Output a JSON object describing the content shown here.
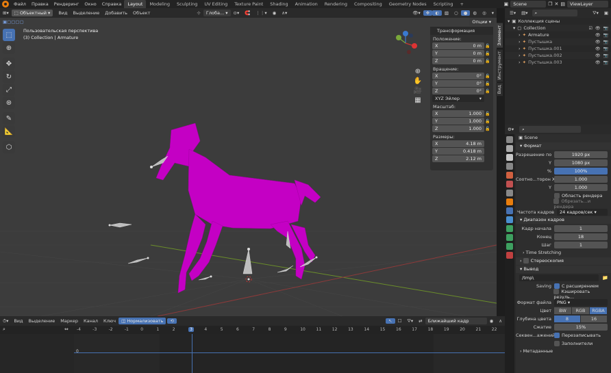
{
  "menu": {
    "items": [
      "Файл",
      "Правка",
      "Рендеринг",
      "Окно",
      "Справка"
    ],
    "workspaces": [
      "Layout",
      "Modeling",
      "Sculpting",
      "UV Editing",
      "Texture Paint",
      "Shading",
      "Animation",
      "Rendering",
      "Compositing",
      "Geometry Nodes",
      "Scripting"
    ],
    "active_workspace": "Layout",
    "scene": "Scene",
    "view_layer": "ViewLayer"
  },
  "viewport_header": {
    "mode": "Объектный",
    "menus": [
      "Вид",
      "Выделение",
      "Добавить",
      "Объект"
    ],
    "orientation": "Глоба...",
    "options": "Опции"
  },
  "viewport_info": {
    "line1": "Пользовательская перспектива",
    "line2": "(3) Collection | Armature"
  },
  "npanel": {
    "title": "Трансформация",
    "location_label": "Положение:",
    "location": [
      {
        "axis": "X",
        "value": "0 m"
      },
      {
        "axis": "Y",
        "value": "0 m"
      },
      {
        "axis": "Z",
        "value": "0 m"
      }
    ],
    "rotation_label": "Вращение:",
    "rotation": [
      {
        "axis": "X",
        "value": "0°"
      },
      {
        "axis": "Y",
        "value": "0°"
      },
      {
        "axis": "Z",
        "value": "0°"
      }
    ],
    "rotation_mode": "XYZ Эйлер",
    "scale_label": "Масштаб:",
    "scale": [
      {
        "axis": "X",
        "value": "1.000"
      },
      {
        "axis": "Y",
        "value": "1.000"
      },
      {
        "axis": "Z",
        "value": "1.000"
      }
    ],
    "dimensions_label": "Размеры:",
    "dimensions": [
      {
        "axis": "X",
        "value": "4.18 m"
      },
      {
        "axis": "Y",
        "value": "0.418 m"
      },
      {
        "axis": "Z",
        "value": "2.12 m"
      }
    ]
  },
  "side_tabs": [
    "Элемент",
    "Инструмент",
    "Вид"
  ],
  "timeline": {
    "menus": [
      "Вид",
      "Выделение",
      "Маркер",
      "Канал",
      "Ключ"
    ],
    "normalize": "Нормализовать",
    "interp": "Ближайший кадр",
    "ticks": [
      "-4",
      "-3",
      "-2",
      "-1",
      "0",
      "1",
      "2",
      "3",
      "4",
      "5",
      "6",
      "7",
      "8",
      "9",
      "10",
      "11",
      "12",
      "13",
      "14",
      "15",
      "16",
      "17",
      "18",
      "19",
      "20",
      "21",
      "22"
    ],
    "current_frame": "3",
    "row_value": "0"
  },
  "outliner": {
    "rows": [
      {
        "label": "Коллекция сцены",
        "indent": 0
      },
      {
        "label": "Collection",
        "indent": 1
      },
      {
        "label": "Armature",
        "indent": 2
      },
      {
        "label": "Пустышка",
        "indent": 2
      },
      {
        "label": "Пустышка.001",
        "indent": 2
      },
      {
        "label": "Пустышка.002",
        "indent": 2
      },
      {
        "label": "Пустышка.003",
        "indent": 2
      }
    ]
  },
  "properties": {
    "scene_name": "Scene",
    "format_title": "Формат",
    "resolution_label": "Разрешение по",
    "res_x": "1920 px",
    "y_label": "Y",
    "res_y": "1080 px",
    "pct_label": "%",
    "res_pct": "100%",
    "aspect_label": "Соотно...торон X",
    "aspect_x": "1.000",
    "aspect_y": "1.000",
    "render_region": "Область рендера",
    "crop_region": "Обрезать...и рендера",
    "fps_label": "Частота кадров",
    "fps": "24 кадров/сек",
    "frame_range_title": "Диапазон кадров",
    "start_label": "Кадр начала",
    "start": "1",
    "end_label": "Конец",
    "end": "18",
    "step_label": "Шаг",
    "step": "1",
    "time_stretching": "Time Stretching",
    "stereoscopy": "Стереоскопия",
    "output_title": "Вывод",
    "output_path": "/tmp\\",
    "saving_label": "Saving",
    "file_ext": "С расширением",
    "cache_result": "Кэшировать резуль...",
    "file_format_label": "Формат файла",
    "file_format": "PNG",
    "color_label": "Цвет",
    "color_modes": [
      "BW",
      "RGB",
      "RGBA"
    ],
    "color_active": "RGBA",
    "depth_label": "Глубина цвета",
    "depths": [
      "8",
      "16"
    ],
    "depth_active": "8",
    "compression_label": "Сжатие",
    "compression": "15%",
    "sequence_label": "Секвен...ажений",
    "overwrite": "Перезаписывать",
    "placeholders": "Заполнители",
    "metadata": "Метаданные"
  },
  "colors": {
    "mesh": "#c400c4",
    "accent": "#4772b3",
    "orange": "#e87d0d"
  }
}
